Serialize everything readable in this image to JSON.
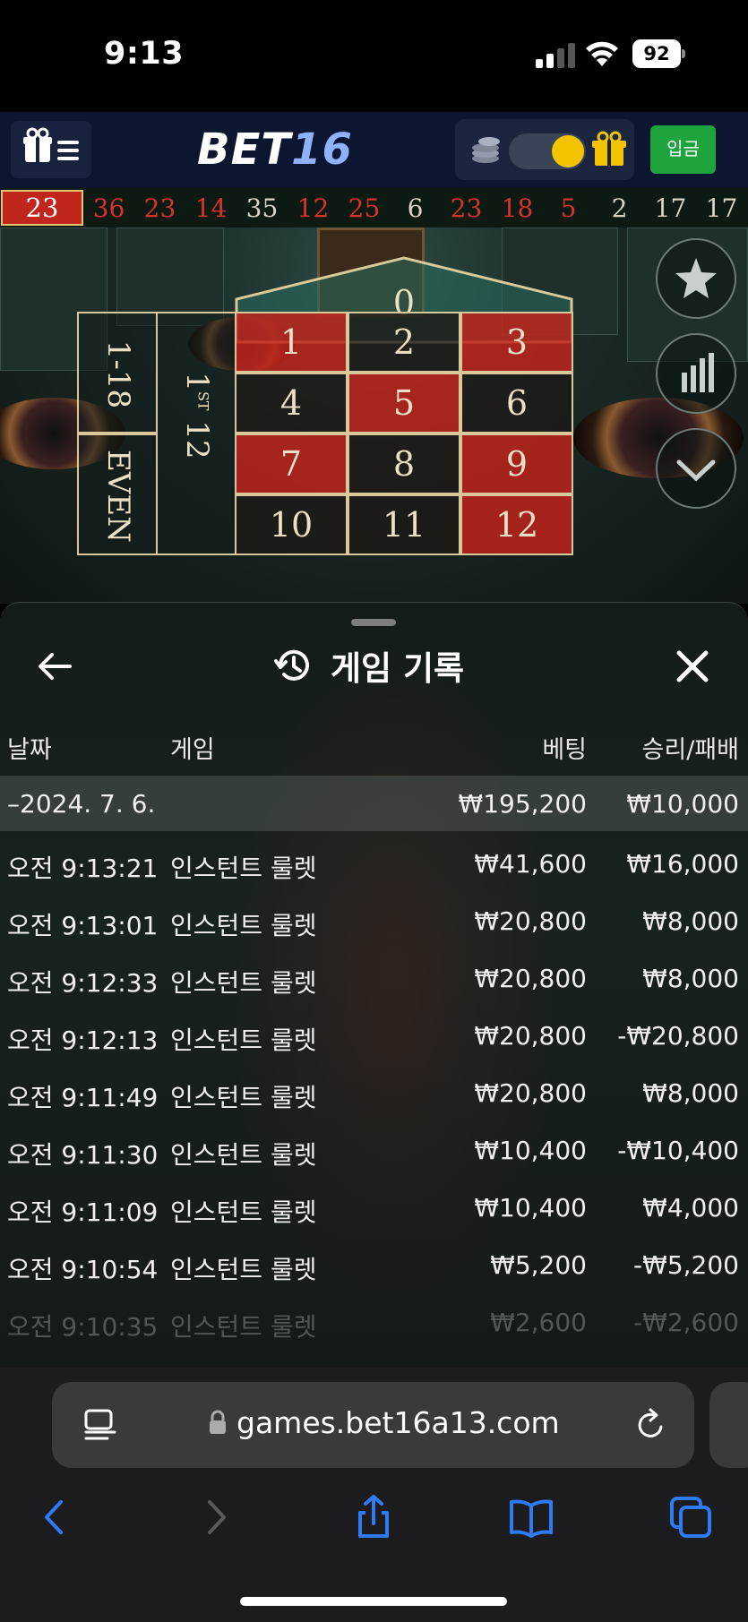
{
  "status_bar": {
    "time": "9:13",
    "battery": "92"
  },
  "header": {
    "logo_main": "BET",
    "logo_num": "16",
    "deposit_label": "입금"
  },
  "results": {
    "current": "23",
    "history": [
      {
        "n": "36",
        "color": "red"
      },
      {
        "n": "23",
        "color": "red"
      },
      {
        "n": "14",
        "color": "red"
      },
      {
        "n": "35",
        "color": "black"
      },
      {
        "n": "12",
        "color": "red"
      },
      {
        "n": "25",
        "color": "red"
      },
      {
        "n": "6",
        "color": "black"
      },
      {
        "n": "23",
        "color": "red"
      },
      {
        "n": "18",
        "color": "red"
      },
      {
        "n": "5",
        "color": "red"
      },
      {
        "n": "2",
        "color": "black"
      },
      {
        "n": "17",
        "color": "black"
      },
      {
        "n": "17",
        "color": "black"
      }
    ]
  },
  "board": {
    "zero": "0",
    "low": "1-18",
    "even": "EVEN",
    "dozen_num": "1",
    "dozen_sup": "ST",
    "dozen_val": "12",
    "numbers": [
      {
        "n": "1",
        "color": "red"
      },
      {
        "n": "2",
        "color": "black"
      },
      {
        "n": "3",
        "color": "red"
      },
      {
        "n": "4",
        "color": "black"
      },
      {
        "n": "5",
        "color": "red"
      },
      {
        "n": "6",
        "color": "black"
      },
      {
        "n": "7",
        "color": "red"
      },
      {
        "n": "8",
        "color": "black"
      },
      {
        "n": "9",
        "color": "red"
      },
      {
        "n": "10",
        "color": "black"
      },
      {
        "n": "11",
        "color": "black"
      },
      {
        "n": "12",
        "color": "red"
      }
    ]
  },
  "sheet": {
    "title": "게임 기록",
    "columns": {
      "date": "날짜",
      "game": "게임",
      "bet": "베팅",
      "result": "승리/패배"
    },
    "day": {
      "date": "–2024. 7. 6.",
      "bet": "₩195,200",
      "result": "₩10,000"
    },
    "rows": [
      {
        "date": "오전 9:13:21",
        "game": "인스턴트 룰렛",
        "bet": "₩41,600",
        "result": "₩16,000"
      },
      {
        "date": "오전 9:13:01",
        "game": "인스턴트 룰렛",
        "bet": "₩20,800",
        "result": "₩8,000"
      },
      {
        "date": "오전 9:12:33",
        "game": "인스턴트 룰렛",
        "bet": "₩20,800",
        "result": "₩8,000"
      },
      {
        "date": "오전 9:12:13",
        "game": "인스턴트 룰렛",
        "bet": "₩20,800",
        "result": "-₩20,800"
      },
      {
        "date": "오전 9:11:49",
        "game": "인스턴트 룰렛",
        "bet": "₩20,800",
        "result": "₩8,000"
      },
      {
        "date": "오전 9:11:30",
        "game": "인스턴트 룰렛",
        "bet": "₩10,400",
        "result": "-₩10,400"
      },
      {
        "date": "오전 9:11:09",
        "game": "인스턴트 룰렛",
        "bet": "₩10,400",
        "result": "₩4,000"
      },
      {
        "date": "오전 9:10:54",
        "game": "인스턴트 룰렛",
        "bet": "₩5,200",
        "result": "-₩5,200"
      },
      {
        "date": "오전 9:10:35",
        "game": "인스턴트 룰렛",
        "bet": "₩2,600",
        "result": "-₩2,600"
      }
    ]
  },
  "browser": {
    "url": "games.bet16a13.com"
  },
  "colors": {
    "accent_green": "#1ea33d",
    "roulette_red": "#c0261b",
    "browser_blue": "#2f7bf5"
  }
}
